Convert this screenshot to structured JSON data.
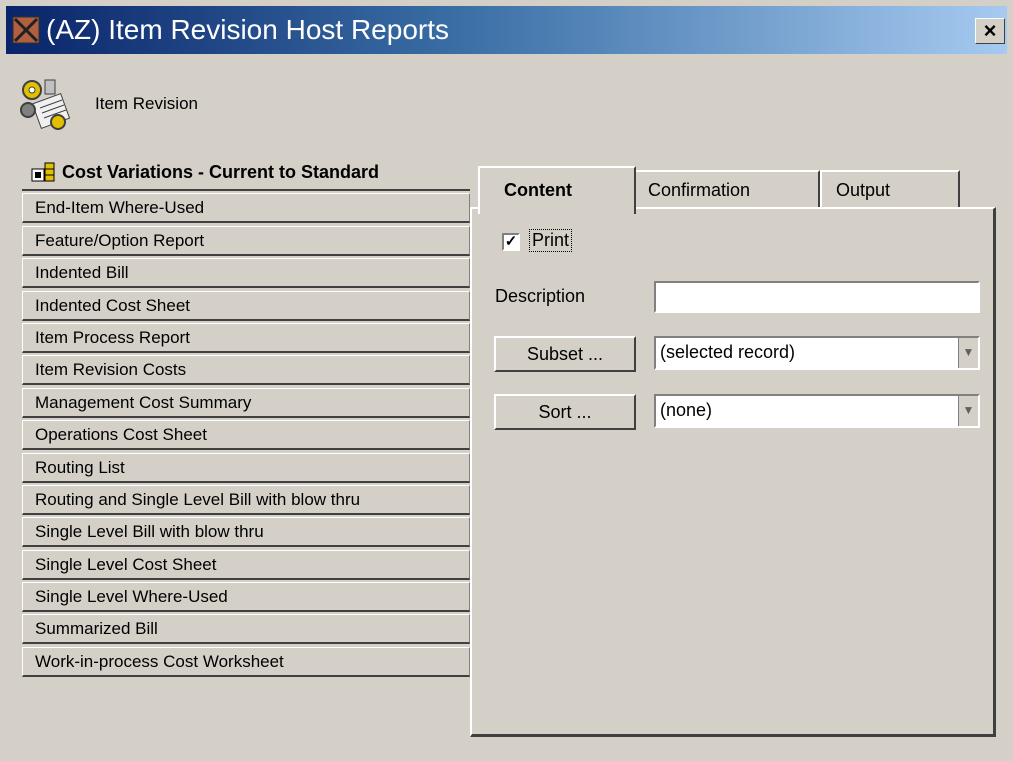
{
  "window": {
    "title": "(AZ) Item Revision Host Reports",
    "close_label": "×"
  },
  "module": {
    "label": "Item Revision",
    "icon": "gears-document-icon"
  },
  "reports": {
    "selected": "Cost Variations - Current to Standard",
    "items": [
      "End-Item Where-Used",
      "Feature/Option Report",
      "Indented Bill",
      "Indented Cost Sheet",
      "Item Process Report",
      "Item Revision Costs",
      "Management Cost Summary",
      "Operations Cost Sheet",
      "Routing List",
      "Routing and Single Level Bill with blow thru",
      "Single Level Bill with blow thru",
      "Single Level Cost Sheet",
      "Single Level Where-Used",
      "Summarized Bill",
      "Work-in-process Cost Worksheet"
    ]
  },
  "tabs": {
    "content": "Content",
    "confirmation": "Confirmation",
    "output": "Output"
  },
  "content": {
    "print_label": "Print",
    "print_checked": true,
    "description_label": "Description",
    "description_value": "",
    "subset_button": "Subset ...",
    "subset_value": "(selected record)",
    "sort_button": "Sort ...",
    "sort_value": "(none)"
  },
  "colors": {
    "title_start": "#0a246a",
    "title_end": "#a6caf0",
    "face": "#d4d0c8"
  }
}
